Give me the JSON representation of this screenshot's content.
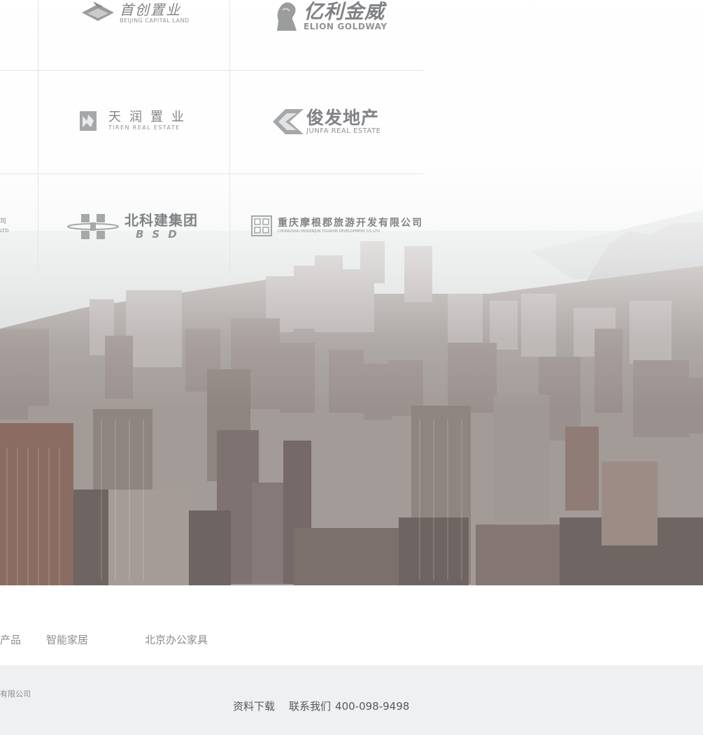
{
  "partners": {
    "shouchuang": {
      "cn": "首创置业",
      "en": "BEIJING CAPITAL LAND"
    },
    "elion": {
      "cn": "亿利金威",
      "en": "ELION GOLDWAY"
    },
    "tiren": {
      "cn": "天润置业",
      "en": "TIREN REAL ESTATE"
    },
    "junfa": {
      "cn": "俊发地产",
      "en": "JUNFA REAL ESTATE"
    },
    "bsd": {
      "cn": "北科建集团",
      "en": "BSD"
    },
    "mogen": {
      "cn": "重庆摩根郡旅游开发有限公司",
      "en": "CHONGQING MOGENJUN TOURISM DEVELOPMENT CO.,LTD."
    },
    "partial_left": {
      "line1": "司",
      "line2": "LTD"
    }
  },
  "product_links": [
    {
      "label": "产品"
    },
    {
      "label": "智能家居"
    },
    {
      "label": "北京办公家具"
    }
  ],
  "footer": {
    "company_partial": "有限公司",
    "download": "资料下载",
    "contact": "联系我们",
    "phone": "400-098-9498"
  },
  "colors": {
    "logo_gray": "#8b8d8f",
    "footer_bg": "#eef0f2",
    "footer_text": "#555a5f",
    "grid_line": "#e3e5e6"
  }
}
